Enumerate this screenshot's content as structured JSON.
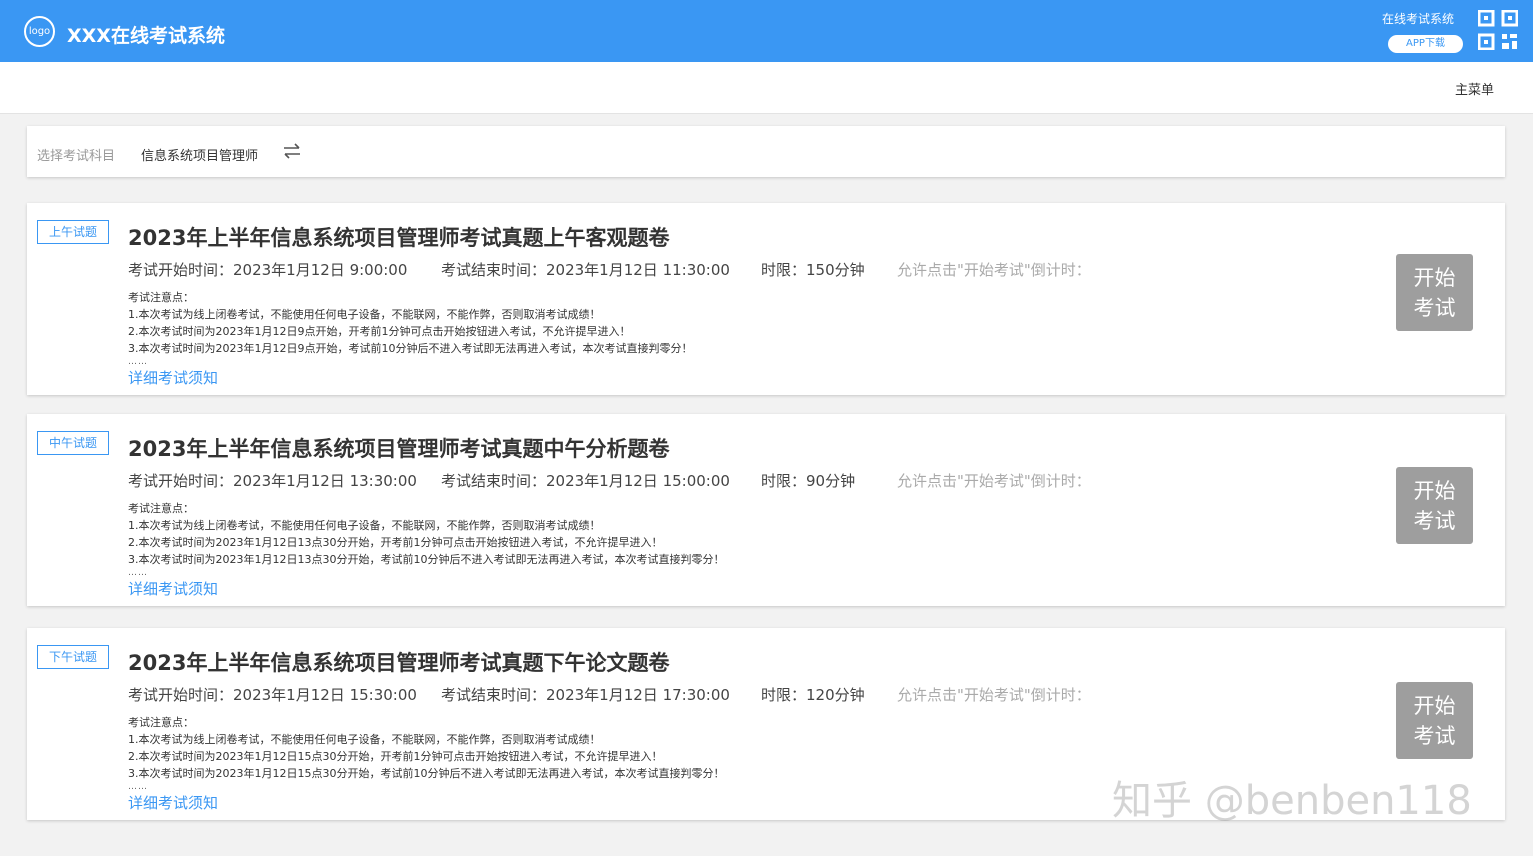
{
  "header": {
    "logo_text": "logo",
    "title": "XXX在线考试系统",
    "right_label": "在线考试系统",
    "app_download": "APP下载",
    "qr_icon": "qr-code-icon",
    "bg_color": "#3a97f3"
  },
  "nav": {
    "main_menu": "主菜单"
  },
  "subject": {
    "label": "选择考试科目",
    "value": "信息系统项目管理师",
    "switch_icon": "swap-icon"
  },
  "exams": [
    {
      "tag": "上午试题",
      "title": "2023年上半年信息系统项目管理师考试真题上午客观题卷",
      "start": "考试开始时间：2023年1月12日 9:00:00",
      "end": "考试结束时间：2023年1月12日 11:30:00",
      "limit": "时限：150分钟",
      "countdown": "允许点击\"开始考试\"倒计时：",
      "notes_title": "考试注意点：",
      "notes": [
        "1.本次考试为线上闭卷考试，不能使用任何电子设备，不能联网，不能作弊，否则取消考试成绩！",
        "2.本次考试时间为2023年1月12日9点开始，开考前1分钟可点击开始按钮进入考试，不允许提早进入！",
        "3.本次考试时间为2023年1月12日9点开始，考试前10分钟后不进入考试即无法再进入考试，本次考试直接判零分！"
      ],
      "ellipsis": "……",
      "detail_link": "详细考试须知",
      "button": [
        "开始",
        "考试"
      ]
    },
    {
      "tag": "中午试题",
      "title": "2023年上半年信息系统项目管理师考试真题中午分析题卷",
      "start": "考试开始时间：2023年1月12日 13:30:00",
      "end": "考试结束时间：2023年1月12日 15:00:00",
      "limit": "时限：90分钟",
      "countdown": "允许点击\"开始考试\"倒计时：",
      "notes_title": "考试注意点：",
      "notes": [
        "1.本次考试为线上闭卷考试，不能使用任何电子设备，不能联网，不能作弊，否则取消考试成绩！",
        "2.本次考试时间为2023年1月12日13点30分开始，开考前1分钟可点击开始按钮进入考试，不允许提早进入！",
        "3.本次考试时间为2023年1月12日13点30分开始，考试前10分钟后不进入考试即无法再进入考试，本次考试直接判零分！"
      ],
      "ellipsis": "……",
      "detail_link": "详细考试须知",
      "button": [
        "开始",
        "考试"
      ]
    },
    {
      "tag": "下午试题",
      "title": "2023年上半年信息系统项目管理师考试真题下午论文题卷",
      "start": "考试开始时间：2023年1月12日 15:30:00",
      "end": "考试结束时间：2023年1月12日 17:30:00",
      "limit": "时限：120分钟",
      "countdown": "允许点击\"开始考试\"倒计时：",
      "notes_title": "考试注意点：",
      "notes": [
        "1.本次考试为线上闭卷考试，不能使用任何电子设备，不能联网，不能作弊，否则取消考试成绩！",
        "2.本次考试时间为2023年1月12日15点30分开始，开考前1分钟可点击开始按钮进入考试，不允许提早进入！",
        "3.本次考试时间为2023年1月12日15点30分开始，考试前10分钟后不进入考试即无法再进入考试，本次考试直接判零分！"
      ],
      "ellipsis": "……",
      "detail_link": "详细考试须知",
      "button": [
        "开始",
        "考试"
      ]
    }
  ],
  "watermark": "知乎 @benben118"
}
